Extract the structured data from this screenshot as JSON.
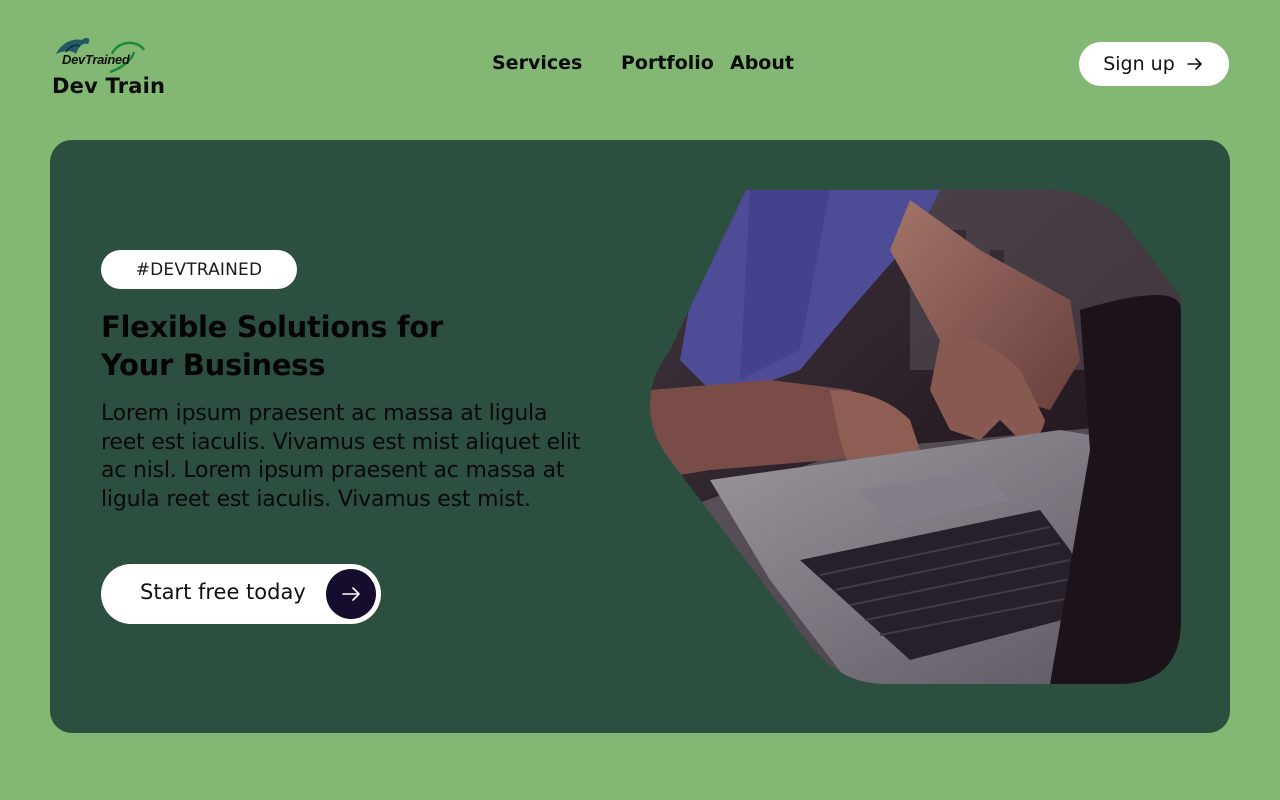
{
  "brand": {
    "logo_text": "DevTrained",
    "name": "Dev Train"
  },
  "nav": {
    "items": [
      "Services",
      "Portfolio",
      "About"
    ]
  },
  "header": {
    "signup_label": "Sign up"
  },
  "hero": {
    "tag": "#DEVTRAINED",
    "headline_line1": "Flexible Solutions for",
    "headline_line2": "Your Business",
    "body": "Lorem ipsum praesent ac massa at ligula reet est iaculis. Vivamus est mist aliquet elit ac nisl. Lorem ipsum praesent ac massa at ligula reet est iaculis. Vivamus est mist.",
    "cta_label": "Start free today"
  },
  "colors": {
    "page_background": "#82b874",
    "hero_background": "#2c4f3f",
    "cta_icon_background": "#150c2e",
    "pill_background": "#ffffff"
  },
  "icons": {
    "signup": "arrow-right-icon",
    "cta": "arrow-right-icon",
    "logo": "bird-icon"
  }
}
